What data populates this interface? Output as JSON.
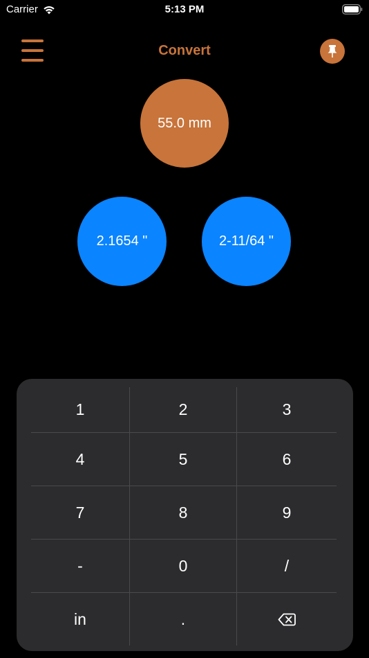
{
  "status_bar": {
    "carrier": "Carrier",
    "time": "5:13 PM"
  },
  "nav": {
    "title": "Convert",
    "menu_icon": "hamburger-menu-icon",
    "pin_icon": "pushpin-icon"
  },
  "conversion": {
    "input_value": "55.0 mm",
    "decimal_inches": "2.1654 \"",
    "fraction_inches": "2-11/64 \""
  },
  "keypad": {
    "keys": [
      "1",
      "2",
      "3",
      "4",
      "5",
      "6",
      "7",
      "8",
      "9",
      "-",
      "0",
      "/",
      "in",
      ".",
      ""
    ],
    "delete_icon": "backspace-icon"
  },
  "colors": {
    "accent_orange": "#c8743a",
    "accent_blue": "#0a84ff",
    "background": "#000000",
    "keypad_bg": "#2c2c2e"
  }
}
